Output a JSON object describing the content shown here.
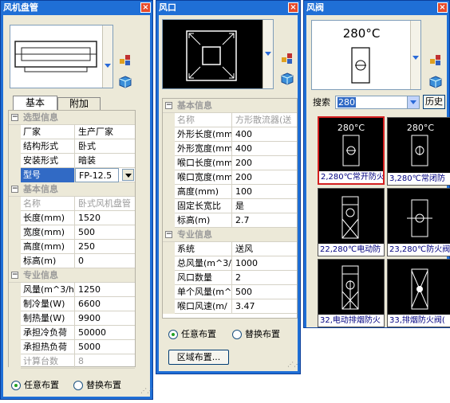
{
  "panel1": {
    "title": "风机盘管",
    "tabs": [
      "基本",
      "附加"
    ],
    "sections": [
      {
        "title": "选型信息",
        "rows": [
          {
            "k": "厂家",
            "v": "生产厂家"
          },
          {
            "k": "结构形式",
            "v": "卧式"
          },
          {
            "k": "安装形式",
            "v": "暗装"
          },
          {
            "k": "型号",
            "v": "FP-12.5"
          }
        ]
      },
      {
        "title": "基本信息",
        "rows": [
          {
            "k": "名称",
            "v": "卧式风机盘管"
          },
          {
            "k": "长度(mm)",
            "v": "1520"
          },
          {
            "k": "宽度(mm)",
            "v": "500"
          },
          {
            "k": "高度(mm)",
            "v": "250"
          },
          {
            "k": "标高(m)",
            "v": "0"
          }
        ]
      },
      {
        "title": "专业信息",
        "rows": [
          {
            "k": "风量(m^3/h)",
            "v": "1250"
          },
          {
            "k": "制冷量(W)",
            "v": "6600"
          },
          {
            "k": "制热量(W)",
            "v": "9900"
          },
          {
            "k": "承担冷负荷",
            "v": "50000"
          },
          {
            "k": "承担热负荷",
            "v": "5000"
          },
          {
            "k": "计算台数",
            "v": "8"
          }
        ]
      }
    ],
    "radio1": "任意布置",
    "radio2": "替换布置"
  },
  "panel2": {
    "title": "风口",
    "sections": [
      {
        "title": "基本信息",
        "rows": [
          {
            "k": "名称",
            "v": "方形散流器(送"
          },
          {
            "k": "外形长度(mm",
            "v": "400"
          },
          {
            "k": "外形宽度(mm",
            "v": "400"
          },
          {
            "k": "喉口长度(mm",
            "v": "200"
          },
          {
            "k": "喉口宽度(mm",
            "v": "200"
          },
          {
            "k": "高度(mm)",
            "v": "100"
          },
          {
            "k": "固定长宽比",
            "v": "是"
          },
          {
            "k": "标高(m)",
            "v": "2.7"
          }
        ]
      },
      {
        "title": "专业信息",
        "rows": [
          {
            "k": "系统",
            "v": "送风"
          },
          {
            "k": "总风量(m^3/",
            "v": "1000"
          },
          {
            "k": "风口数量",
            "v": "2"
          },
          {
            "k": "单个风量(m^",
            "v": "500"
          },
          {
            "k": "喉口风速(m/",
            "v": "3.47"
          }
        ]
      }
    ],
    "radio1": "任意布置",
    "radio2": "替换布置",
    "area_button": "区域布置..."
  },
  "panel3": {
    "title": "风阀",
    "preview_temp": "280°C",
    "search_label": "搜索",
    "search_value": "280",
    "history_button": "历史",
    "tiles": [
      {
        "temp": "280°C",
        "caption": "2,280℃常开防火"
      },
      {
        "temp": "280°C",
        "caption": "3,280℃常闭防"
      },
      {
        "temp": "",
        "caption": "22,280℃电动防"
      },
      {
        "temp": "",
        "caption": "23,280℃防火阀"
      },
      {
        "temp": "",
        "caption": "32,电动排烟防火"
      },
      {
        "temp": "",
        "caption": "33,排烟防火阀("
      }
    ]
  },
  "colors": {
    "title_bar": "#1f6fd6",
    "close_button": "#e54a2a",
    "selected_tile_border": "#d42020"
  }
}
